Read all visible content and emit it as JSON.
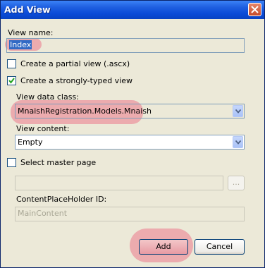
{
  "window": {
    "title": "Add View"
  },
  "form": {
    "view_name_label": "View name:",
    "view_name_value": "Index",
    "partial_view_label": "Create a partial view (.ascx)",
    "partial_view_checked": false,
    "strongly_typed_label": "Create a strongly-typed view",
    "strongly_typed_checked": true,
    "view_data_class_label": "View data class:",
    "view_data_class_value": "MnaishRegistration.Models.Mnaish",
    "view_content_label": "View content:",
    "view_content_value": "Empty",
    "master_page_label": "Select master page",
    "master_page_checked": false,
    "master_page_path": "",
    "browse_label": "...",
    "placeholder_id_label": "ContentPlaceHolder ID:",
    "placeholder_id_value": "MainContent"
  },
  "buttons": {
    "add_label": "Add",
    "cancel_label": "Cancel"
  }
}
